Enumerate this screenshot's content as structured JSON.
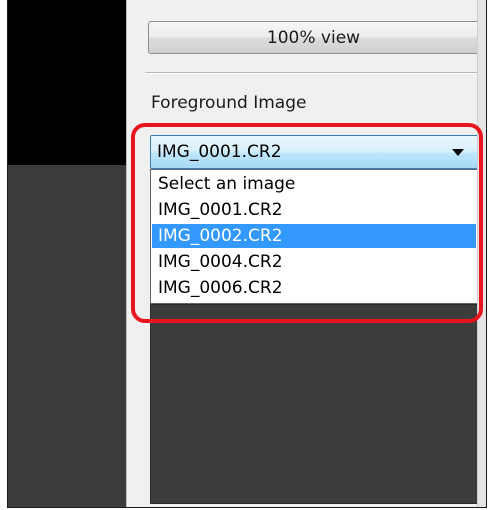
{
  "panel": {
    "view_button_label": "100% view",
    "foreground_label": "Foreground Image"
  },
  "foreground_select": {
    "selected_value": "IMG_0001.CR2",
    "options": [
      "Select an image",
      "IMG_0001.CR2",
      "IMG_0002.CR2",
      "IMG_0004.CR2",
      "IMG_0006.CR2"
    ],
    "highlighted_option": "IMG_0002.CR2"
  },
  "colors": {
    "highlight_border": "#e8141e",
    "option_highlight": "#3399ff"
  }
}
